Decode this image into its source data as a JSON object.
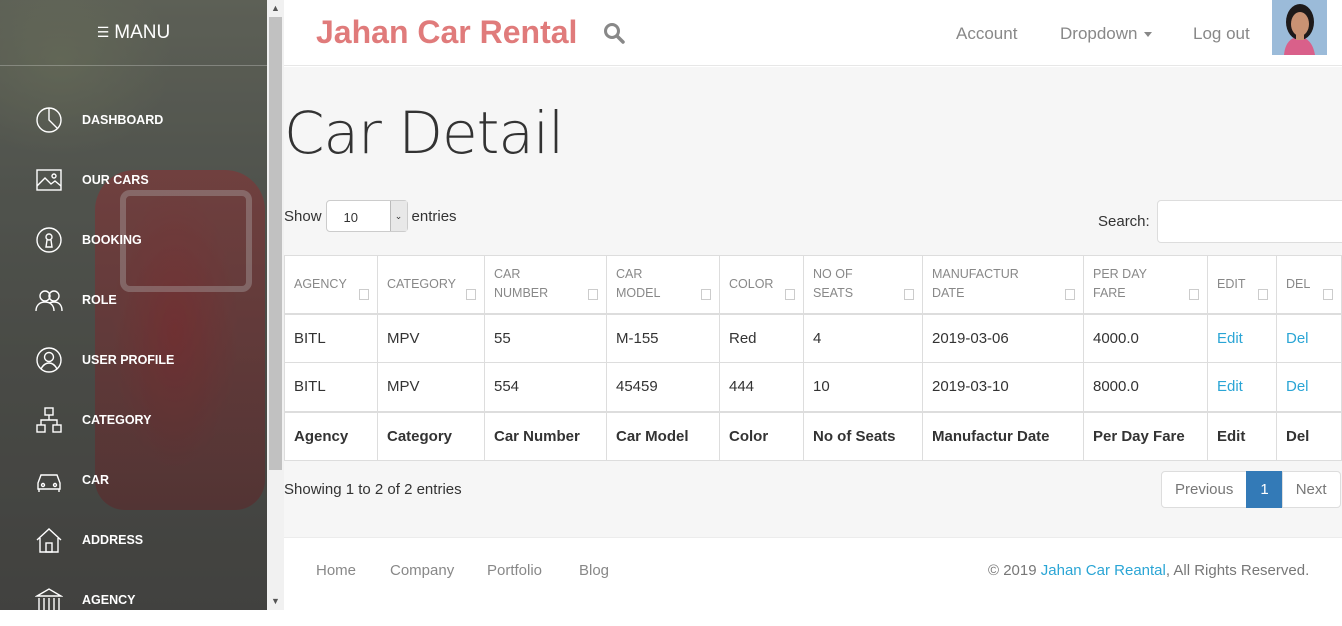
{
  "sidebar": {
    "menu_label": "MANU",
    "items": [
      {
        "label": "DASHBOARD",
        "icon": "dashboard-icon"
      },
      {
        "label": "OUR CARS",
        "icon": "image-icon"
      },
      {
        "label": "BOOKING",
        "icon": "keyhole-icon"
      },
      {
        "label": "ROLE",
        "icon": "users-icon"
      },
      {
        "label": "USER PROFILE",
        "icon": "user-icon"
      },
      {
        "label": "CATEGORY",
        "icon": "sitemap-icon"
      },
      {
        "label": "CAR",
        "icon": "car-icon"
      },
      {
        "label": "ADDRESS",
        "icon": "home-icon"
      },
      {
        "label": "AGENCY",
        "icon": "bank-icon"
      }
    ]
  },
  "header": {
    "brand": "Jahan Car Rental",
    "account": "Account",
    "dropdown": "Dropdown",
    "logout": "Log out"
  },
  "main": {
    "title": "Car Detail",
    "show_label": "Show",
    "entries_value": "10",
    "entries_label": "entries",
    "search_label": "Search:",
    "columns": [
      "AGENCY",
      "CATEGORY",
      "CAR NUMBER",
      "CAR MODEL",
      "COLOR",
      "NO OF SEATS",
      "MANUFACTUR DATE",
      "PER DAY FARE",
      "EDIT",
      "DEL"
    ],
    "rows": [
      [
        "BITL",
        "MPV",
        "55",
        "M-155",
        "Red",
        "4",
        "2019-03-06",
        "4000.0",
        "Edit",
        "Del"
      ],
      [
        "BITL",
        "MPV",
        "554",
        "45459",
        "444",
        "10",
        "2019-03-10",
        "8000.0",
        "Edit",
        "Del"
      ]
    ],
    "footer_columns": [
      "Agency",
      "Category",
      "Car Number",
      "Car Model",
      "Color",
      "No of Seats",
      "Manufactur Date",
      "Per Day Fare",
      "Edit",
      "Del"
    ],
    "info": "Showing 1 to 2 of 2 entries",
    "pagination": {
      "previous": "Previous",
      "current": "1",
      "next": "Next"
    }
  },
  "footer": {
    "links": [
      "Home",
      "Company",
      "Portfolio",
      "Blog"
    ],
    "copy_prefix": "© 2019 ",
    "copy_brand": "Jahan Car Reantal",
    "copy_suffix": ", All Rights Reserved."
  },
  "colors": {
    "brand": "#e07b7b",
    "link": "#2aa5d5",
    "active_page": "#337ab7"
  }
}
